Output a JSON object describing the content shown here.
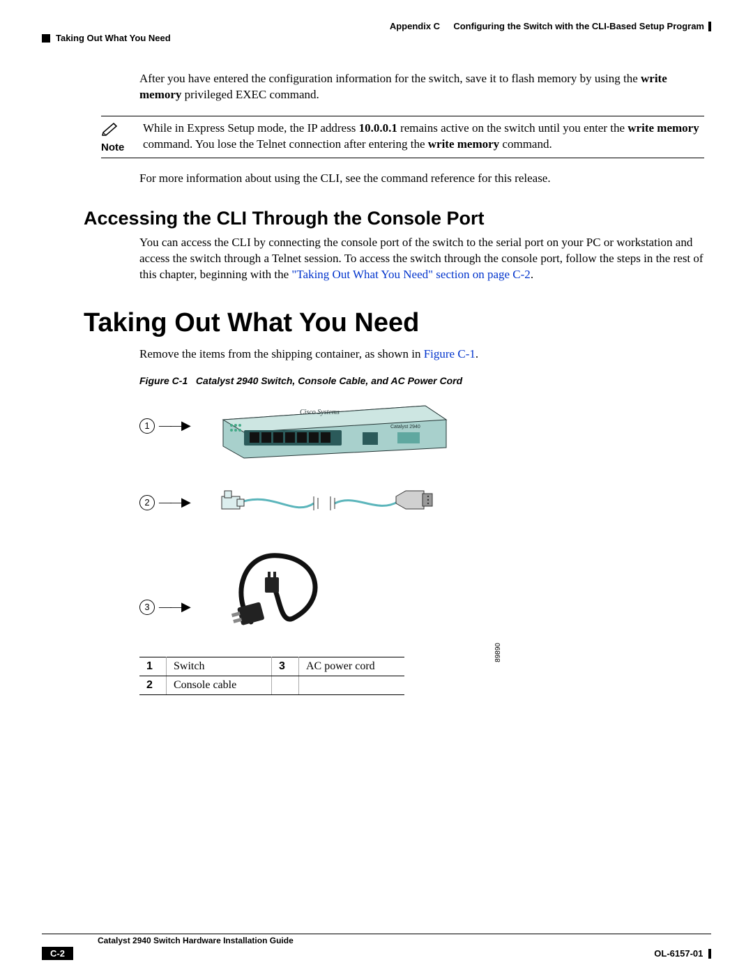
{
  "header": {
    "appendix_label": "Appendix C",
    "appendix_title": "Configuring the Switch with the CLI-Based Setup Program",
    "section_title": "Taking Out What You Need"
  },
  "intro": {
    "p1a": "After you have entered the configuration information for the switch, save it to flash memory by using the ",
    "p1b": "write memory",
    "p1c": " privileged EXEC command."
  },
  "note": {
    "label": "Note",
    "t1": "While in Express Setup mode, the IP address ",
    "ip": "10.0.0.1",
    "t2": " remains active on the switch until you enter the ",
    "cmd1": "write memory",
    "t3": "  command. You lose the Telnet connection after entering the ",
    "cmd2": "write memory",
    "t4": " command."
  },
  "para2": "For more information about using the CLI, see the command reference for this release.",
  "h2": "Accessing the CLI Through the Console Port",
  "h2_body": {
    "t1": "You can access the CLI by connecting the console port of the switch to the serial port on your PC or workstation and access the switch through a Telnet session. To access the switch through the console port, follow the steps in the rest of this chapter, beginning with the ",
    "link": "\"Taking Out What You Need\" section on page C-2",
    "t2": "."
  },
  "h1": "Taking Out What You Need",
  "h1_body": {
    "t1": "Remove the items from the shipping container, as shown in ",
    "link": "Figure C-1",
    "t2": "."
  },
  "figure": {
    "caption_num": "Figure C-1",
    "caption_text": "Catalyst 2940 Switch, Console Cable, and AC Power Cord",
    "id": "89890",
    "callouts": {
      "c1": "1",
      "c2": "2",
      "c3": "3"
    }
  },
  "legend": {
    "r1n": "1",
    "r1t": "Switch",
    "r2n": "2",
    "r2t": "Console cable",
    "r3n": "3",
    "r3t": "AC power cord"
  },
  "footer": {
    "guide": "Catalyst 2940 Switch Hardware Installation Guide",
    "pagenum": "C-2",
    "docid": "OL-6157-01"
  }
}
